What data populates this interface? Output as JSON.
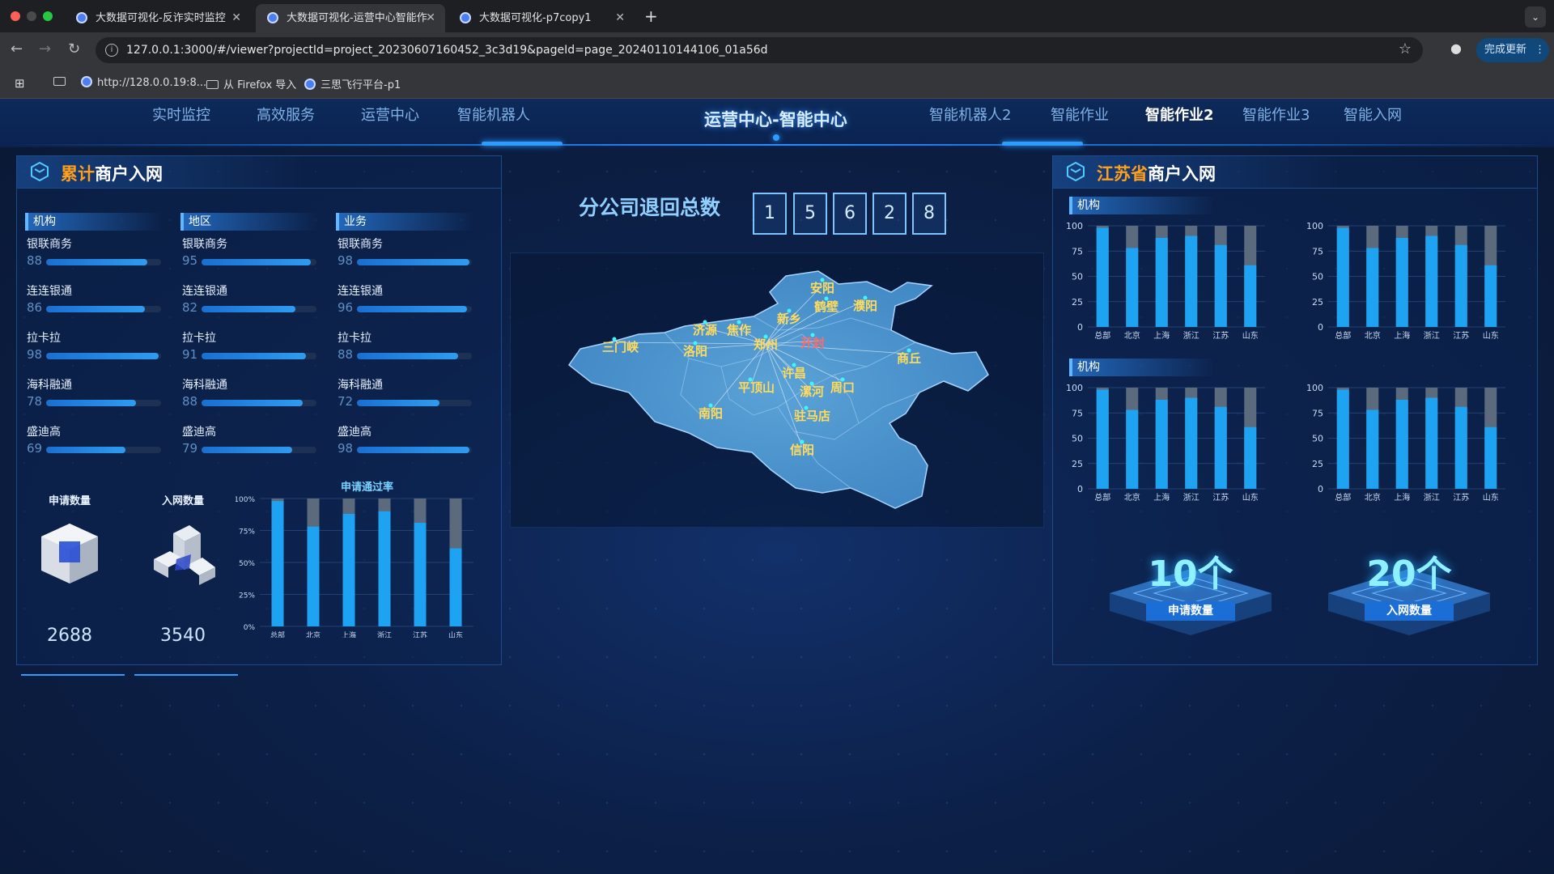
{
  "browser": {
    "tabs": [
      {
        "title": "大数据可视化-反诈实时监控",
        "active": false
      },
      {
        "title": "大数据可视化-运营中心智能作",
        "active": true
      },
      {
        "title": "大数据可视化-p7copy1",
        "active": false
      }
    ],
    "url": "127.0.0.1:3000/#/viewer?projectId=project_20230607160452_3c3d19&pageId=page_20240110144106_01a56d",
    "update_button": "完成更新",
    "bookmarks": [
      "http://128.0.0.19:8...",
      "从 Firefox 导入",
      "三思飞行平台-p1"
    ]
  },
  "nav": {
    "left": [
      "实时监控",
      "高效服务",
      "运营中心",
      "智能机器人"
    ],
    "title": "运营中心-智能中心",
    "right": [
      "智能机器人2",
      "智能作业",
      "智能作业2",
      "智能作业3",
      "智能入网"
    ],
    "active": "智能作业2"
  },
  "left_panel": {
    "title_highlight": "累计",
    "title_rest": "商户入网",
    "columns": [
      {
        "header": "机构",
        "items": [
          {
            "name": "银联商务",
            "value": 88
          },
          {
            "name": "连连银通",
            "value": 86
          },
          {
            "name": "拉卡拉",
            "value": 98
          },
          {
            "name": "海科融通",
            "value": 78
          },
          {
            "name": "盛迪高",
            "value": 69
          }
        ]
      },
      {
        "header": "地区",
        "items": [
          {
            "name": "银联商务",
            "value": 95
          },
          {
            "name": "连连银通",
            "value": 82
          },
          {
            "name": "拉卡拉",
            "value": 91
          },
          {
            "name": "海科融通",
            "value": 88
          },
          {
            "name": "盛迪高",
            "value": 79
          }
        ]
      },
      {
        "header": "业务",
        "items": [
          {
            "name": "银联商务",
            "value": 98
          },
          {
            "name": "连连银通",
            "value": 96
          },
          {
            "name": "拉卡拉",
            "value": 88
          },
          {
            "name": "海科融通",
            "value": 72
          },
          {
            "name": "盛迪高",
            "value": 98
          }
        ]
      }
    ],
    "apply": {
      "label": "申请数量",
      "value": "2688"
    },
    "join": {
      "label": "入网数量",
      "value": "3540"
    }
  },
  "center": {
    "count_label": "分公司退回总数",
    "digits": [
      "1",
      "5",
      "6",
      "2",
      "8"
    ],
    "map_cities": [
      "安阳",
      "鹤壁",
      "濮阳",
      "新乡",
      "济源",
      "焦作",
      "三门峡",
      "洛阳",
      "郑州",
      "开封",
      "商丘",
      "许昌",
      "平顶山",
      "漯河",
      "周口",
      "南阳",
      "驻马店",
      "信阳"
    ]
  },
  "right_panel": {
    "title_highlight": "江苏省",
    "title_rest": "商户入网",
    "sub1": "机构",
    "sub2": "机构",
    "counters": [
      {
        "num": "10个",
        "label": "申请数量"
      },
      {
        "num": "20个",
        "label": "入网数量"
      }
    ]
  },
  "chart_data": [
    {
      "type": "bar",
      "title": "申请通过率",
      "categories": [
        "总部",
        "北京",
        "上海",
        "浙江",
        "江苏",
        "山东"
      ],
      "series": [
        {
          "name": "申请通过率",
          "values": [
            98,
            78,
            88,
            90,
            81,
            61
          ]
        }
      ],
      "yticks": [
        "100%",
        "75%",
        "50%",
        "25%",
        "0%"
      ],
      "ylim": [
        0,
        100
      ]
    },
    {
      "type": "bar",
      "categories": [
        "总部",
        "北京",
        "上海",
        "浙江",
        "江苏",
        "山东"
      ],
      "series": [
        {
          "values": [
            98,
            78,
            88,
            90,
            81,
            61
          ]
        }
      ],
      "yticks": [
        "100",
        "75",
        "50",
        "25",
        "0"
      ],
      "ylim": [
        0,
        100
      ]
    },
    {
      "type": "bar",
      "categories": [
        "总部",
        "北京",
        "上海",
        "浙江",
        "江苏",
        "山东"
      ],
      "series": [
        {
          "values": [
            98,
            78,
            88,
            90,
            81,
            61
          ]
        }
      ],
      "yticks": [
        "100",
        "75",
        "50",
        "25",
        "0"
      ],
      "ylim": [
        0,
        100
      ]
    },
    {
      "type": "bar",
      "categories": [
        "总部",
        "北京",
        "上海",
        "浙江",
        "江苏",
        "山东"
      ],
      "series": [
        {
          "values": [
            98,
            78,
            88,
            90,
            81,
            61
          ]
        }
      ],
      "yticks": [
        "100",
        "75",
        "50",
        "25",
        "0"
      ],
      "ylim": [
        0,
        100
      ]
    },
    {
      "type": "bar",
      "categories": [
        "总部",
        "北京",
        "上海",
        "浙江",
        "江苏",
        "山东"
      ],
      "series": [
        {
          "values": [
            98,
            78,
            88,
            90,
            81,
            61
          ]
        }
      ],
      "yticks": [
        "100",
        "75",
        "50",
        "25",
        "0"
      ],
      "ylim": [
        0,
        100
      ]
    }
  ]
}
